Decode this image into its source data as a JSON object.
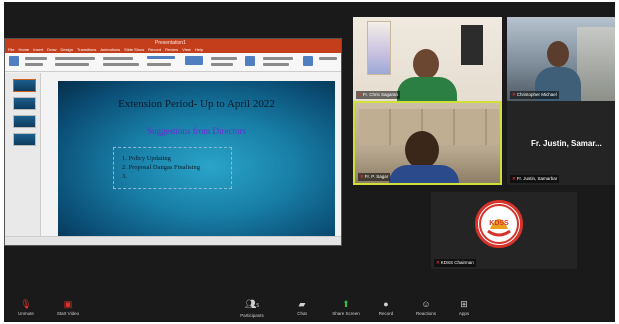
{
  "ppt": {
    "window_title": "Presentation1",
    "tabs": [
      "File",
      "Home",
      "Insert",
      "Draw",
      "Design",
      "Transitions",
      "Animations",
      "Slide Show",
      "Record",
      "Review",
      "View",
      "Help"
    ],
    "status_right": "",
    "slide": {
      "title": "Extension Period- Up to April 2022",
      "subtitle": "Suggestions from Directors",
      "items": [
        "1.  Policy Updating",
        "2.  Proposal Dangas Finalising",
        "3."
      ]
    }
  },
  "participants": {
    "tile1_name": "Fr. Chris Sagaran",
    "tile2_name": "Christopher Michael",
    "tile3_name": "Fr. P. Sagar",
    "tile4_name": "Fr. Justin, Samar...",
    "tile4_label": "Fr. Justin, Samarbar",
    "tile5_name": "KDSS Chairman",
    "tile5_logo_text": "KDSS"
  },
  "toolbar": {
    "unmute": "Unmute",
    "start_video": "Start Video",
    "participants": "Participants",
    "participants_count": "5",
    "chat": "Chat",
    "share_screen": "Share Screen",
    "record": "Record",
    "reactions": "Reactions",
    "apps": "Apps"
  },
  "colors": {
    "ppt_accent": "#c43e1c",
    "active_speaker": "#cfe03a",
    "share_green": "#2fc14a",
    "mute_red": "#e0322c"
  }
}
